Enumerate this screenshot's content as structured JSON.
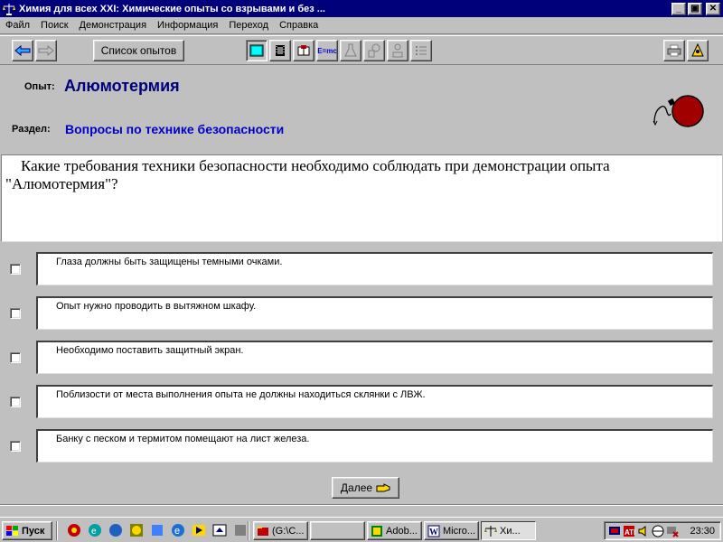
{
  "window": {
    "title": "Химия для всех XXI: Химические опыты со взрывами и без ...",
    "controls": {
      "minimize": "_",
      "maximize": "▣",
      "close": "✕"
    }
  },
  "menu": [
    "Файл",
    "Поиск",
    "Демонстрация",
    "Информация",
    "Переход",
    "Справка"
  ],
  "toolbar": {
    "experiments_list": "Список опытов",
    "equation_icon_text": "E=mc"
  },
  "experiment": {
    "label": "Опыт:",
    "name": "Алюмотермия",
    "section_label": "Раздел:",
    "section": "Вопросы по технике безопасности"
  },
  "question": "Какие требования техники безопасности необходимо соблюдать при демонстрации опыта \"Алюмотермия\"?",
  "answers": [
    {
      "text": "Глаза должны быть защищены темными очками.",
      "checked": false
    },
    {
      "text": "Опыт нужно проводить в вытяжном шкафу.",
      "checked": false
    },
    {
      "text": "Необходимо поставить защитный экран.",
      "checked": false
    },
    {
      "text": "Поблизости от места выполнения опыта не должны находиться склянки с ЛВЖ.",
      "checked": false
    },
    {
      "text": "Банку с песком и термитом помещают на лист железа.",
      "checked": false
    }
  ],
  "next_button": "Далее",
  "taskbar": {
    "start": "Пуск",
    "tasks": [
      "(G:\\C...",
      "",
      "Adob...",
      "Micro...",
      "Хи..."
    ],
    "clock": "23:30"
  }
}
